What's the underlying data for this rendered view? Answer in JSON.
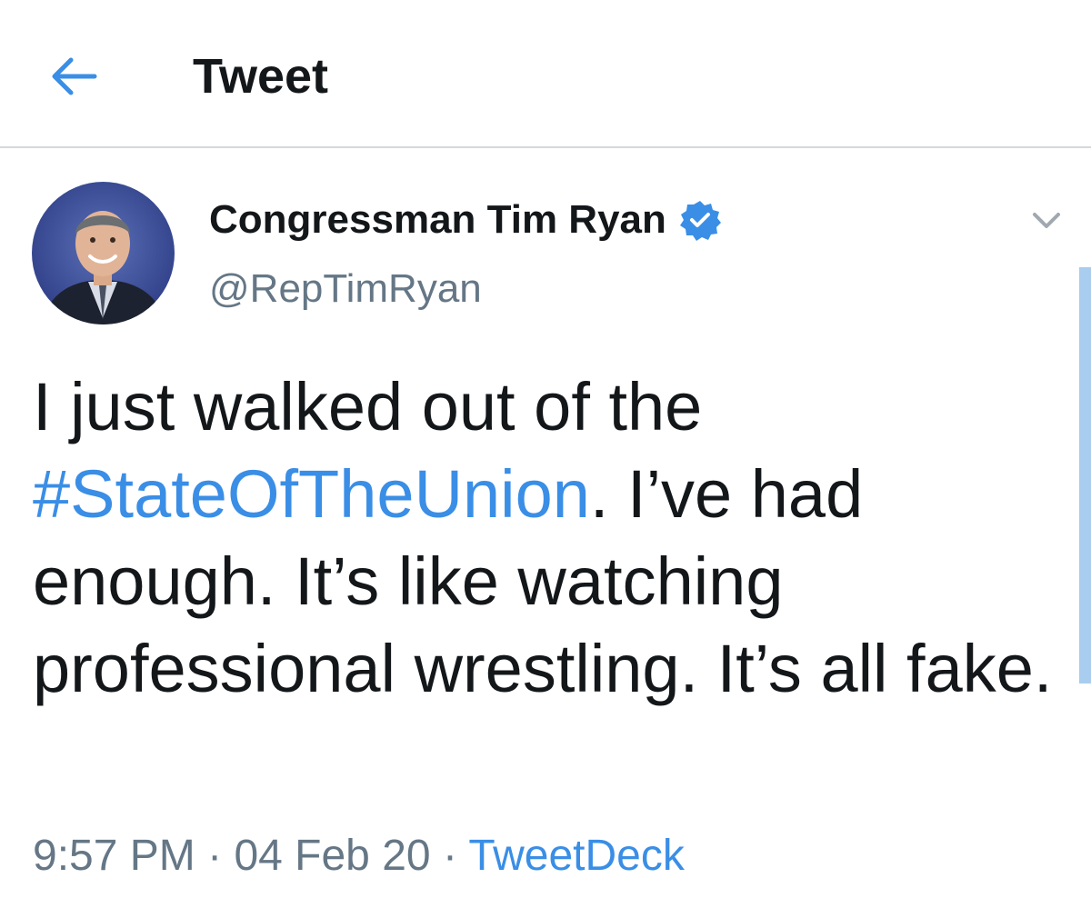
{
  "header": {
    "title": "Tweet",
    "back_icon": "arrow-left-icon"
  },
  "tweet": {
    "author": {
      "display_name": "Congressman Tim Ryan",
      "handle": "@RepTimRyan",
      "verified": true,
      "verified_icon": "verified-badge-icon"
    },
    "menu_icon": "chevron-down-icon",
    "text_before": "I just walked out of the ",
    "hashtag": "#StateOfTheUnion",
    "text_after": ". I’ve had enough. It’s like watching professional wrestling. It’s all fake.",
    "time": "9:57 PM",
    "separator": "·",
    "date": "04 Feb 20",
    "source": "TweetDeck"
  },
  "colors": {
    "accent": "#3a8ee6",
    "text_primary": "#14171a",
    "text_secondary": "#657786",
    "divider": "#d4d8dc",
    "scrollbar": "#a9cdee"
  }
}
